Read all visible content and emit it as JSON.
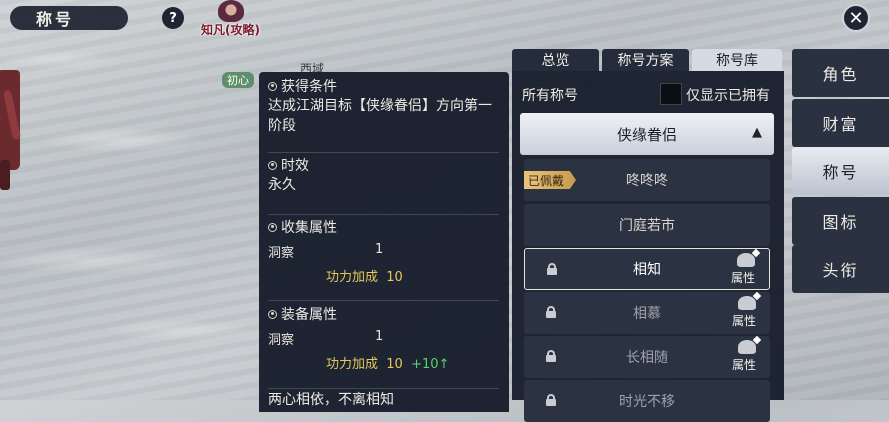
{
  "header": {
    "title": "称号",
    "help_label": "?",
    "close_label": "✕"
  },
  "scene": {
    "guide_label": "知凡(攻略)",
    "npc_name": "西域",
    "player_tag": "初心"
  },
  "tabs": [
    {
      "label": "总览",
      "active": false
    },
    {
      "label": "称号方案",
      "active": false
    },
    {
      "label": "称号库",
      "active": true
    }
  ],
  "panel": {
    "all_titles_label": "所有称号",
    "owned_only_label": "仅显示已拥有",
    "category": {
      "label": "侠缘眷侣",
      "arrow": "▲"
    },
    "items": [
      {
        "label": "咚咚咚",
        "badge": "已佩戴",
        "locked": false,
        "attr": ""
      },
      {
        "label": "门庭若市",
        "badge": "",
        "locked": false,
        "attr": ""
      },
      {
        "label": "相知",
        "badge": "",
        "locked": true,
        "attr": "属性"
      },
      {
        "label": "相慕",
        "badge": "",
        "locked": true,
        "attr": "属性"
      },
      {
        "label": "长相随",
        "badge": "",
        "locked": true,
        "attr": "属性"
      },
      {
        "label": "时光不移",
        "badge": "",
        "locked": true,
        "attr": ""
      }
    ]
  },
  "tooltip": {
    "obtain": {
      "heading": "获得条件",
      "text": "达成江湖目标【侠缘眷侣】方向第一阶段"
    },
    "duration": {
      "heading": "时效",
      "text": "永久"
    },
    "collect": {
      "heading": "收集属性",
      "attr_name": "洞察",
      "attr_value": "1",
      "power_label": "功力加成",
      "power_value": "10"
    },
    "equip": {
      "heading": "装备属性",
      "attr_name": "洞察",
      "attr_value": "1",
      "power_label": "功力加成",
      "power_value": "10",
      "power_bonus": "+10↑"
    },
    "footer": "两心相依，不离相知"
  },
  "sidebar": [
    {
      "label": "角色",
      "active": false
    },
    {
      "label": "财富",
      "active": false
    },
    {
      "label": "称号",
      "active": true
    },
    {
      "label": "图标",
      "active": false
    },
    {
      "label": "头衔",
      "active": false
    }
  ]
}
